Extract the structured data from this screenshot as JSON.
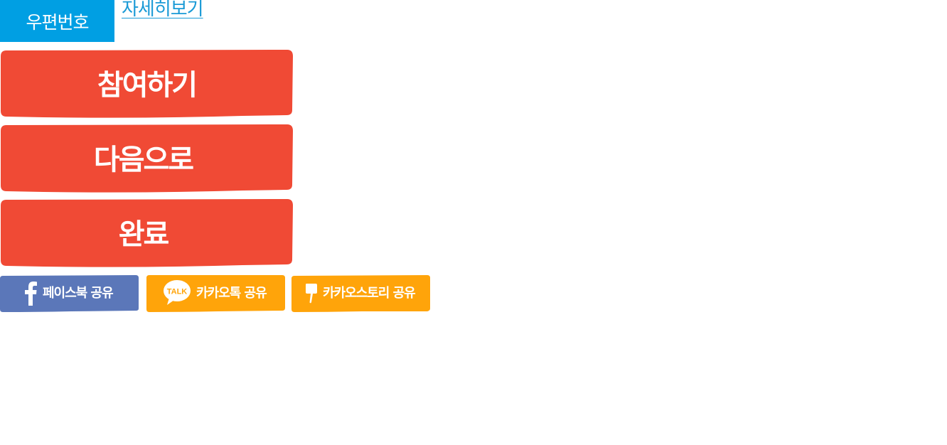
{
  "zipcode": {
    "label": "우편번호"
  },
  "detail_link": {
    "label": "자세히보기"
  },
  "buttons": {
    "join": "참여하기",
    "next": "다음으로",
    "done": "완료"
  },
  "share": {
    "facebook": {
      "label": "페이스북 공유",
      "icon": "facebook-icon",
      "color": "#5b77b9"
    },
    "kakaotalk": {
      "label": "카카오톡 공유",
      "icon": "kakaotalk-icon",
      "icon_text": "TALK",
      "color": "#ffa40a"
    },
    "kakaostory": {
      "label": "카카오스토리 공유",
      "icon": "kakaostory-icon",
      "color": "#ffa40a"
    }
  },
  "colors": {
    "zip_bg": "#009fe3",
    "link": "#1a9ad6",
    "button_red": "#f04a35"
  }
}
